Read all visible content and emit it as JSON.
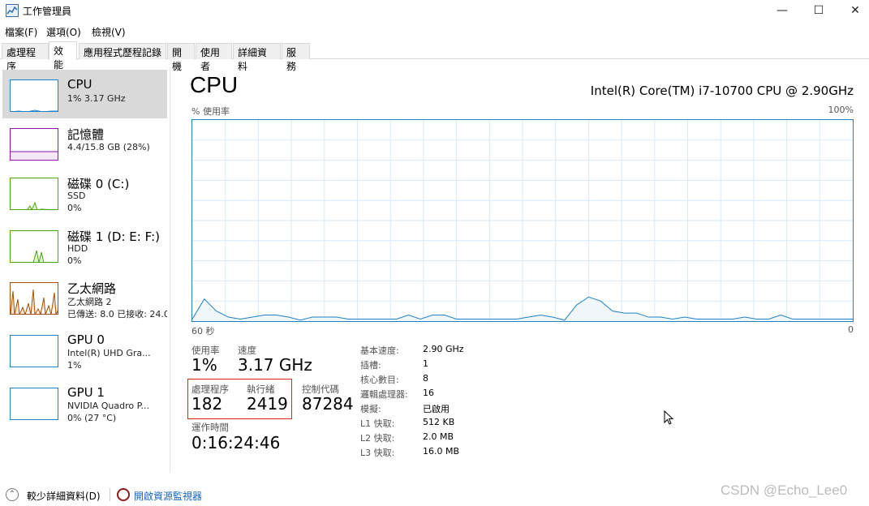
{
  "window": {
    "title": "工作管理員"
  },
  "menu": [
    "檔案(F)",
    "選項(O)",
    "檢視(V)"
  ],
  "tabs": [
    "處理程序",
    "效能",
    "應用程式歷程記錄",
    "開機",
    "使用者",
    "詳細資料",
    "服務"
  ],
  "sidebar": {
    "items": [
      {
        "name": "CPU",
        "line1": "1% 3.17 GHz",
        "line2": "",
        "color": "#1e82c4"
      },
      {
        "name": "記憶體",
        "line1": "4.4/15.8 GB (28%)",
        "line2": "",
        "color": "#8b17a8"
      },
      {
        "name": "磁碟 0 (C:)",
        "line1": "SSD",
        "line2": "0%",
        "color": "#4da60c"
      },
      {
        "name": "磁碟 1 (D: E: F:)",
        "line1": "HDD",
        "line2": "0%",
        "color": "#4da60c"
      },
      {
        "name": "乙太網路",
        "line1": "乙太網路 2",
        "line2": "已傳送: 8.0 已接收: 24.0",
        "color": "#a74f01"
      },
      {
        "name": "GPU 0",
        "line1": "Intel(R) UHD Gra...",
        "line2": "1%",
        "color": "#1e82c4"
      },
      {
        "name": "GPU 1",
        "line1": "NVIDIA Quadro P...",
        "line2": "0% (27 °C)",
        "color": "#1e82c4"
      }
    ]
  },
  "main": {
    "title": "CPU",
    "model": "Intel(R) Core(TM) i7-10700 CPU @ 2.90GHz",
    "graph_label_left": "% 使用率",
    "graph_label_right": "100%",
    "axis_left": "60 秒",
    "axis_right": "0",
    "stats": {
      "utilization_label": "使用率",
      "utilization": "1%",
      "speed_label": "速度",
      "speed": "3.17 GHz",
      "processes_label": "處理程序",
      "processes": "182",
      "threads_label": "執行緒",
      "threads": "2419",
      "handles_label": "控制代碼",
      "handles": "87284",
      "uptime_label": "運作時間",
      "uptime": "0:16:24:46"
    },
    "details": [
      {
        "label": "基本速度:",
        "value": "2.90 GHz"
      },
      {
        "label": "插槽:",
        "value": "1"
      },
      {
        "label": "核心數目:",
        "value": "8"
      },
      {
        "label": "邏輯處理器:",
        "value": "16"
      },
      {
        "label": "模擬:",
        "value": "已啟用"
      },
      {
        "label": "L1 快取:",
        "value": "512 KB"
      },
      {
        "label": "L2 快取:",
        "value": "2.0 MB"
      },
      {
        "label": "L3 快取:",
        "value": "16.0 MB"
      }
    ],
    "cpu_usage_history": [
      1,
      11,
      5,
      2,
      1,
      2,
      3,
      3,
      2,
      0.5,
      2,
      2,
      2,
      1,
      1,
      1,
      1,
      1,
      3,
      1,
      3,
      3,
      1,
      1,
      1,
      1,
      1,
      1,
      2,
      3,
      2,
      0.5,
      8,
      12,
      10,
      5,
      4,
      4,
      2,
      2,
      1,
      2,
      1,
      1,
      1,
      1,
      2,
      1,
      1,
      3,
      1,
      1,
      1,
      1,
      1,
      1
    ]
  },
  "footer": {
    "fewer_details": "較少詳細資料(D)",
    "open_resmon": "開啟資源監視器"
  },
  "watermark": "CSDN @Echo_Lee0"
}
